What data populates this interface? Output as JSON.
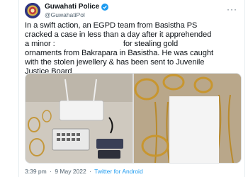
{
  "account": {
    "display_name": "Guwahati Police",
    "handle": "@GuwahatiPol",
    "verified": true
  },
  "tweet": {
    "text_lines": [
      "In a swift action, an EGPD team from Basistha PS",
      "cracked a case in less than a day after it apprehended",
      "a minor :                                for stealing gold",
      "ornaments from Bakrapara in Basistha. He was caught",
      "with the stolen jewellery & has been sent to Juvenile",
      "Justice Board"
    ]
  },
  "media": {
    "left_image": "photo of recovered ornaments, router and power banks on table",
    "right_image": "photo of gold bangles and chains with redacted area"
  },
  "footer": {
    "time": "3:39 pm",
    "separator": "·",
    "date": "9 May 2022",
    "source": "Twitter for Android"
  },
  "colors": {
    "link_blue": "#1d9bf0",
    "muted_text": "#536471",
    "avatar_bg": "#3b3f8f"
  }
}
